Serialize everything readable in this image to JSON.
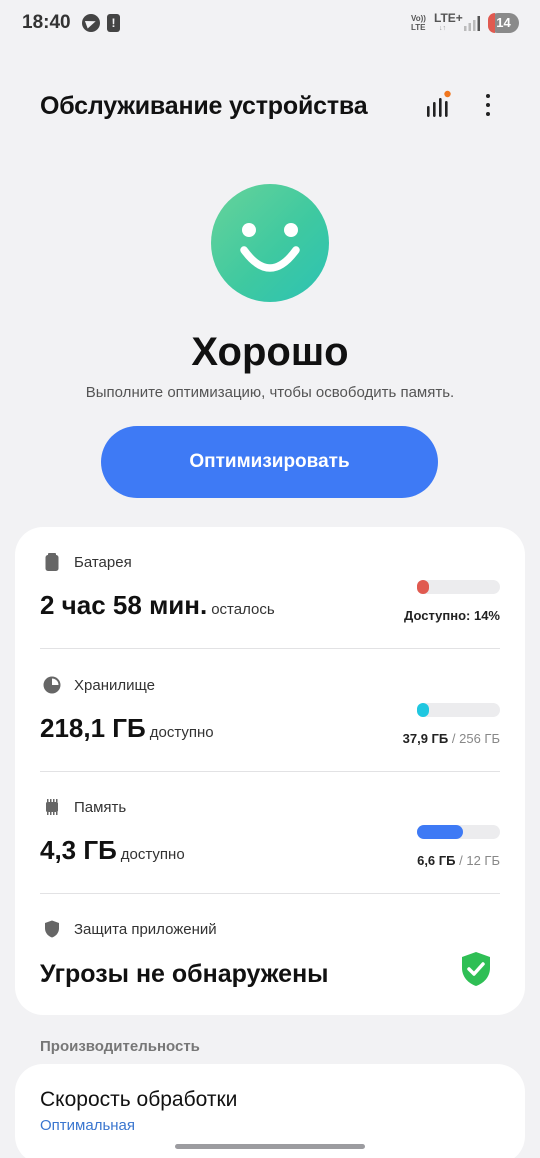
{
  "status_bar": {
    "time": "18:40",
    "volte_line1": "Vo))",
    "volte_line2": "LTE",
    "network": "LTE+",
    "network_sub": "↓↑",
    "battery_level": "14"
  },
  "appbar": {
    "title": "Обслуживание устройства",
    "stats_icon": "bar-chart-icon",
    "more_icon": "more-vertical-icon"
  },
  "status": {
    "title": "Хорошо",
    "subtitle": "Выполните оптимизацию, чтобы освободить память.",
    "button_label": "Оптимизировать",
    "face_icon": "smiley-face-icon"
  },
  "battery": {
    "label": "Батарея",
    "value": "2 час 58 мин.",
    "suffix": "осталось",
    "info": "Доступно: 14%",
    "fill_percent": 14,
    "color": "#e05a50"
  },
  "storage": {
    "label": "Хранилище",
    "value": "218,1 ГБ",
    "suffix": "доступно",
    "used": "37,9 ГБ",
    "separator": " / ",
    "total": "256 ГБ",
    "fill_percent": 14.8,
    "color": "#1fc7e0"
  },
  "memory": {
    "label": "Память",
    "value": "4,3 ГБ",
    "suffix": "доступно",
    "used": "6,6 ГБ",
    "separator": " / ",
    "total": "12 ГБ",
    "fill_percent": 55,
    "color": "#3e7af5"
  },
  "app_protection": {
    "label": "Защита приложений",
    "value": "Угрозы не обнаружены",
    "status_color": "#2fbf55"
  },
  "performance": {
    "header": "Производительность",
    "title": "Скорость обработки",
    "subtitle": "Оптимальная"
  }
}
